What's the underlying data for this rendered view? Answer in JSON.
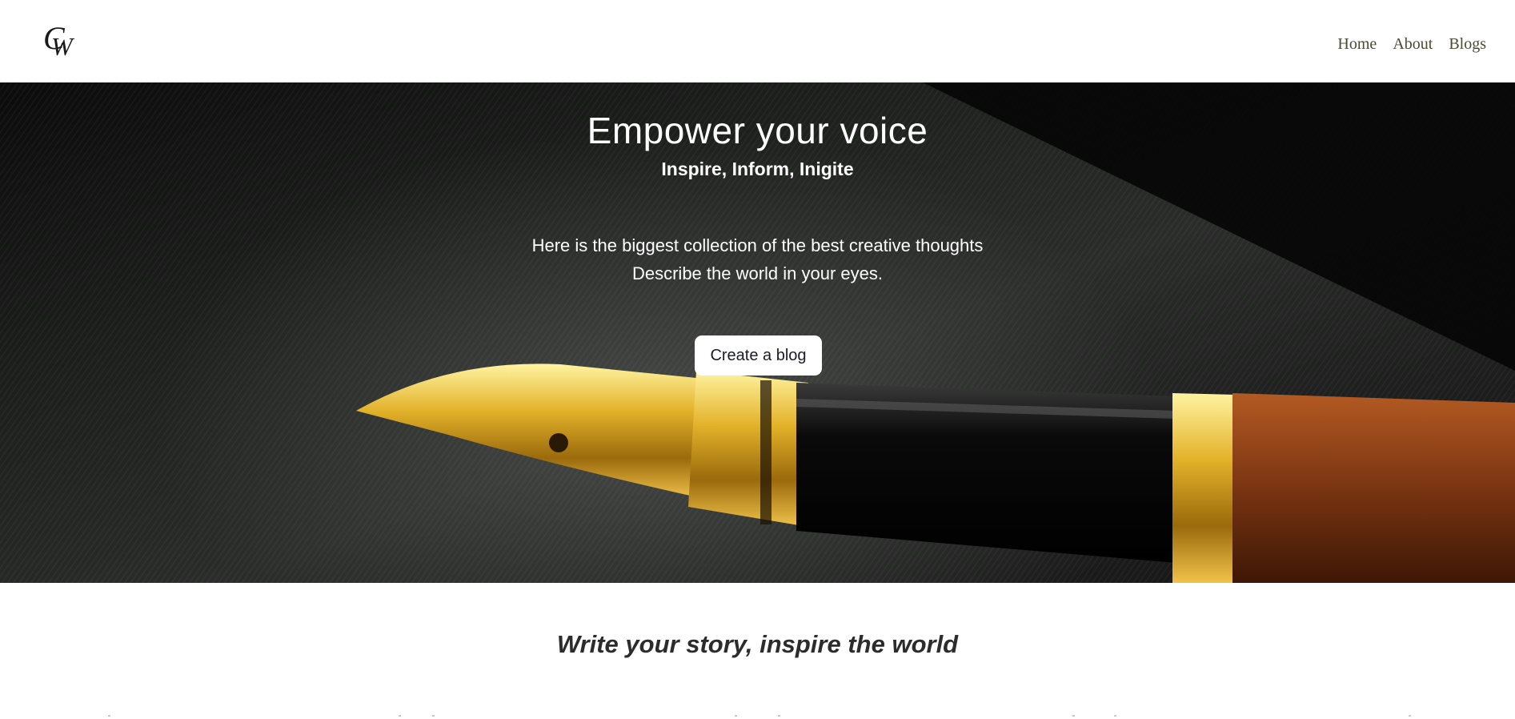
{
  "header": {
    "logo_text": "CW",
    "nav": [
      {
        "label": "Home"
      },
      {
        "label": "About"
      },
      {
        "label": "Blogs"
      }
    ]
  },
  "hero": {
    "title": "Empower your voice",
    "subtitle": "Inspire, Inform, Inigite",
    "description_line1": "Here is the biggest collection of the best creative thoughts",
    "description_line2": "Describe the world in your eyes.",
    "cta_label": "Create a blog",
    "image_subject": "fountain-pen-on-dark-fabric"
  },
  "section": {
    "tagline": "Write your story, inspire the world"
  },
  "colors": {
    "nav_text": "#4a4a36",
    "hero_text": "#ffffff",
    "button_bg": "#ffffff",
    "button_text": "#1b1b2a",
    "tagline_text": "#2c2c2c"
  }
}
